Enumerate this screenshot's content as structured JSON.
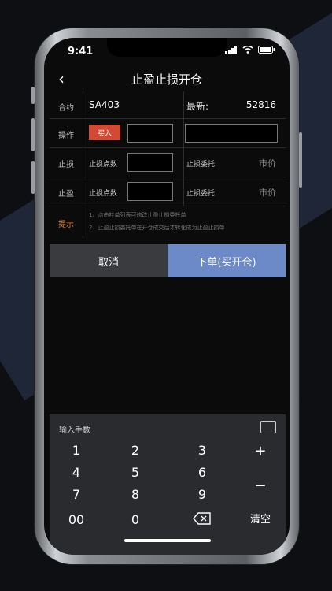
{
  "status": {
    "time": "9:41"
  },
  "nav": {
    "back": "‹",
    "title": "止盈止损开仓"
  },
  "form": {
    "contract_label": "合约",
    "contract_value": "SA403",
    "latest_label": "最新:",
    "latest_value": "52816",
    "action_label": "操作",
    "buy_label": "买入",
    "stop_loss_label": "止损",
    "stop_loss_points": "止损点数",
    "stop_loss_order": "止损委托",
    "stop_loss_price": "市价",
    "take_profit_label": "止盈",
    "take_profit_points": "止损点数",
    "take_profit_order": "止损委托",
    "take_profit_price": "市价",
    "hint_label": "提示",
    "hint_1": "1、点击挂单列表可修改止盈止损委托单",
    "hint_2": "2、止盈止损委托单在开仓成交后才转化成为止盈止损单"
  },
  "buttons": {
    "cancel": "取消",
    "order": "下单(买开仓)"
  },
  "keyboard": {
    "placeholder": "输入手数",
    "k1": "1",
    "k2": "2",
    "k3": "3",
    "plus": "+",
    "k4": "4",
    "k5": "5",
    "k6": "6",
    "minus": "−",
    "k7": "7",
    "k8": "8",
    "k9": "9",
    "k00": "00",
    "k0": "0",
    "clear": "清空"
  },
  "colors": {
    "accent": "#6c8ac7",
    "buy": "#d34a34",
    "hint": "#d77a3a"
  }
}
